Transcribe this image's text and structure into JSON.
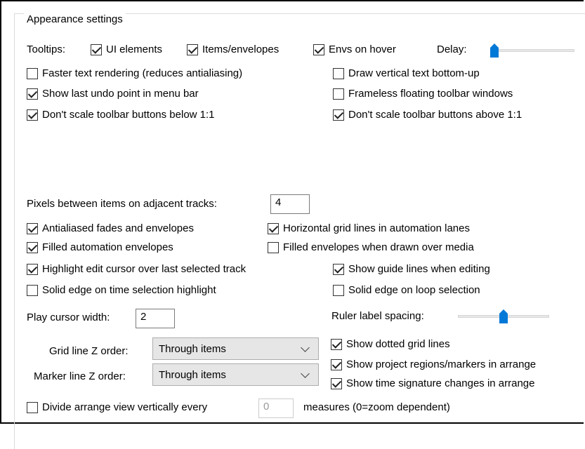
{
  "appearance": {
    "title": "Appearance settings",
    "tooltips": {
      "label": "Tooltips:",
      "ui_elements": {
        "label": "UI elements",
        "checked": true
      },
      "items_envelopes": {
        "label": "Items/envelopes",
        "checked": true
      },
      "envs_on_hover": {
        "label": "Envs on hover",
        "checked": true
      },
      "delay_label": "Delay:",
      "delay_value": 0.0
    },
    "options_left": [
      {
        "label": "Faster text rendering (reduces antialiasing)",
        "checked": false
      },
      {
        "label": "Show last undo point in menu bar",
        "checked": true
      },
      {
        "label": "Don't scale toolbar buttons below 1:1",
        "checked": true
      }
    ],
    "options_right": [
      {
        "label": "Draw vertical text bottom-up",
        "checked": false
      },
      {
        "label": "Frameless floating toolbar windows",
        "checked": false
      },
      {
        "label": "Don't scale toolbar buttons above 1:1",
        "checked": true
      }
    ]
  },
  "tracks": {
    "pixels_label": "Pixels between items on adjacent tracks:",
    "pixels_value": "4",
    "options_left": [
      {
        "label": "Antialiased fades and envelopes",
        "checked": true
      },
      {
        "label": "Filled automation envelopes",
        "checked": true
      },
      {
        "label": "Highlight edit cursor over last selected track",
        "checked": true
      },
      {
        "label": "Solid edge on time selection highlight",
        "checked": false
      }
    ],
    "options_right": [
      {
        "label": "Horizontal grid lines in automation lanes",
        "checked": true
      },
      {
        "label": "Filled envelopes when drawn over media",
        "checked": false
      },
      {
        "label": "Show guide lines when editing",
        "checked": true
      },
      {
        "label": "Solid edge on loop selection",
        "checked": false
      }
    ],
    "play_cursor_label": "Play cursor width:",
    "play_cursor_value": "2",
    "ruler_label": "Ruler label spacing:",
    "ruler_value": 0.5,
    "grid_z_label": "Grid line Z order:",
    "grid_z_value": "Through items",
    "marker_z_label": "Marker line Z order:",
    "marker_z_value": "Through items",
    "options_grid": [
      {
        "label": "Show dotted grid lines",
        "checked": true
      },
      {
        "label": "Show project regions/markers in arrange",
        "checked": true
      },
      {
        "label": "Show time signature changes in arrange",
        "checked": true
      }
    ],
    "divide": {
      "label": "Divide arrange view vertically every",
      "checked": false,
      "value": "0",
      "suffix": "measures (0=zoom dependent)"
    }
  }
}
